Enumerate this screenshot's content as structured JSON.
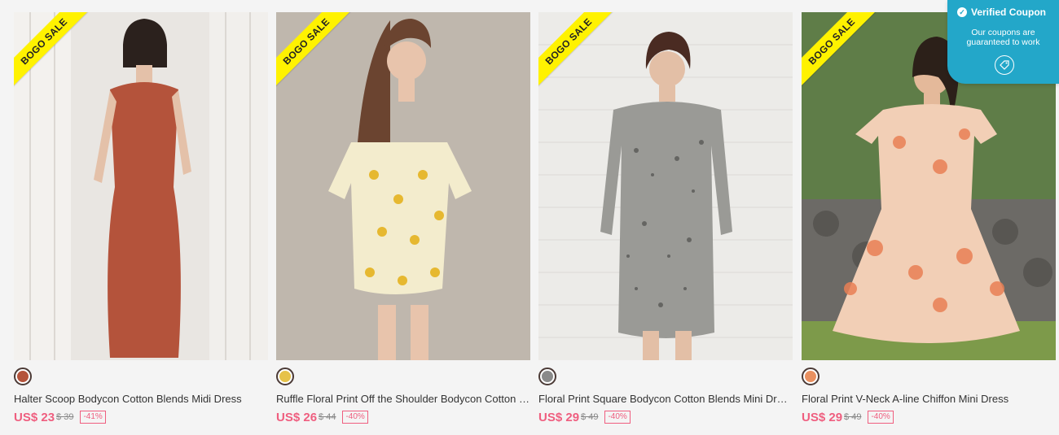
{
  "products": [
    {
      "badge": "BOGO SALE",
      "title": "Halter Scoop Bodycon Cotton Blends Midi Dress",
      "price": "US$ 23",
      "old_price": "$ 39",
      "discount": "-41%",
      "swatch_color": "#b4533b"
    },
    {
      "badge": "BOGO SALE",
      "title": "Ruffle Floral Print Off the Shoulder Bodycon Cotton Blends Mini Dress",
      "price": "US$ 26",
      "old_price": "$ 44",
      "discount": "-40%",
      "swatch_color": "#e6c24a"
    },
    {
      "badge": "BOGO SALE",
      "title": "Floral Print Square Bodycon Cotton Blends Mini Dress",
      "price": "US$ 29",
      "old_price": "$ 49",
      "discount": "-40%",
      "swatch_color": "#8a8a8a"
    },
    {
      "badge": "BOGO SALE",
      "title": "Floral Print V-Neck A-line Chiffon Mini Dress",
      "price": "US$ 29",
      "old_price": "$ 49",
      "discount": "-40%",
      "swatch_color": "#e99060"
    }
  ],
  "coupon": {
    "title": "Verified Coupon",
    "line1": "Our coupons are",
    "line2": "guaranteed to work",
    "icon": "tag-icon"
  },
  "colors": {
    "accent": "#ef5e7f",
    "badge": "#fff200",
    "coupon_bg": "#23a7c9"
  }
}
